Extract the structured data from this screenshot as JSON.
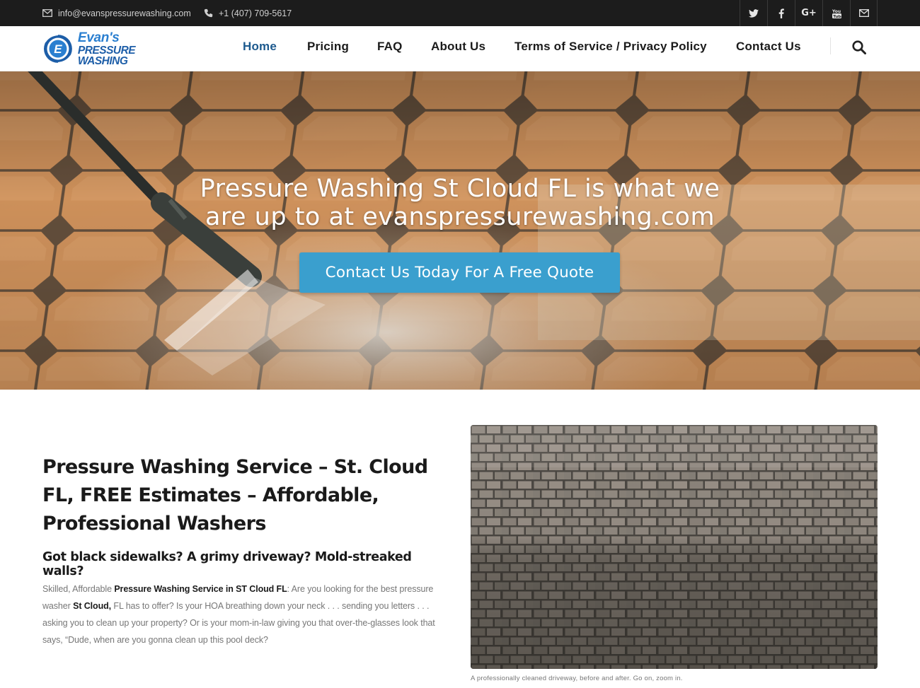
{
  "topbar": {
    "email": "info@evanspressurewashing.com",
    "phone": "+1 (407) 709-5617",
    "social": [
      {
        "icon": "twitter-icon",
        "glyph": "🐦"
      },
      {
        "icon": "facebook-icon",
        "glyph": "f"
      },
      {
        "icon": "google-plus-icon",
        "glyph": "G+"
      },
      {
        "icon": "youtube-icon",
        "glyph": "▶"
      },
      {
        "icon": "mail-icon",
        "glyph": "✉"
      }
    ]
  },
  "logo": {
    "line1": "Evan's",
    "line2": "PRESSURE WASHING",
    "mark_letter": "E"
  },
  "nav": {
    "items": [
      {
        "label": "Home",
        "active": true
      },
      {
        "label": "Pricing",
        "active": false
      },
      {
        "label": "FAQ",
        "active": false
      },
      {
        "label": "About Us",
        "active": false
      },
      {
        "label": "Terms of Service / Privacy Policy",
        "active": false
      },
      {
        "label": "Contact Us",
        "active": false
      }
    ]
  },
  "hero": {
    "headline_line1": "Pressure Washing St Cloud FL is what we",
    "headline_line2": "are up to at evanspressurewashing.com",
    "cta": "Contact Us Today For A Free Quote"
  },
  "content": {
    "title": "Pressure Washing Service – St. Cloud FL, FREE Estimates – Affordable, Professional Washers",
    "subtitle": "Got black sidewalks? A grimy driveway? Mold-streaked walls?",
    "para_intro": "Skilled, Affordable ",
    "para_bold1": "Pressure Washing Service in ST Cloud FL",
    "para_mid": ": Are you looking for the best pressure washer ",
    "para_bold2": "St Cloud,",
    "para_rest": " FL has to offer? Is your HOA breathing down your neck . . . sending you letters . . . asking you to clean up your property? Or is your mom-in-law giving you that over-the-glasses look that says, “Dude, when are you gonna clean up this pool deck?",
    "caption": "A professionally cleaned driveway, before and after. Go on, zoom in."
  },
  "colors": {
    "topbar_bg": "#1c1c1c",
    "nav_active": "#1d5a8e",
    "cta_bg": "#3a9fce",
    "brand_blue": "#2a7fd0"
  }
}
